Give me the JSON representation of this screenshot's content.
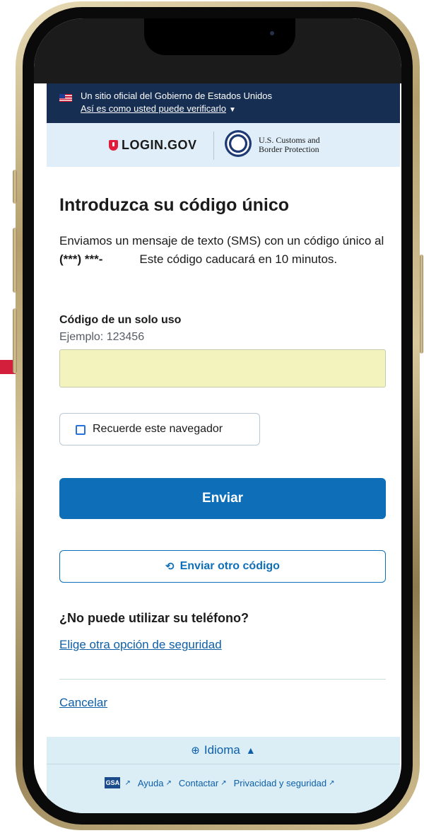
{
  "gov_banner": {
    "line1": "Un sitio oficial del Gobierno de Estados Unidos",
    "line2": "Así es como usted puede verificarlo"
  },
  "header": {
    "login_logo": "LOGIN.GOV",
    "agency_line1": "U.S. Customs and",
    "agency_line2": "Border Protection"
  },
  "main": {
    "title": "Introduzca su código único",
    "body_part1": "Enviamos un mensaje de texto (SMS) con un código único al ",
    "phone_masked": "(***) ***-",
    "body_part2": "Este código caducará en 10 minutos.",
    "field_label": "Código de un solo uso",
    "field_hint": "Ejemplo: 123456",
    "field_value": "",
    "remember_label": "Recuerde este navegador",
    "submit_label": "Enviar",
    "resend_label": "Enviar otro código",
    "subheading": "¿No puede utilizar su teléfono?",
    "alt_link": "Elige otra opción de seguridad",
    "cancel_link": "Cancelar"
  },
  "footer": {
    "language_label": "Idioma",
    "gsa_label": "GSA",
    "links": [
      "Ayuda",
      "Contactar",
      "Privacidad y seguridad"
    ]
  },
  "colors": {
    "banner": "#162e51",
    "primary": "#0e6fb8",
    "input_fill": "#f3f4bd",
    "marker": "#d41f3c"
  }
}
